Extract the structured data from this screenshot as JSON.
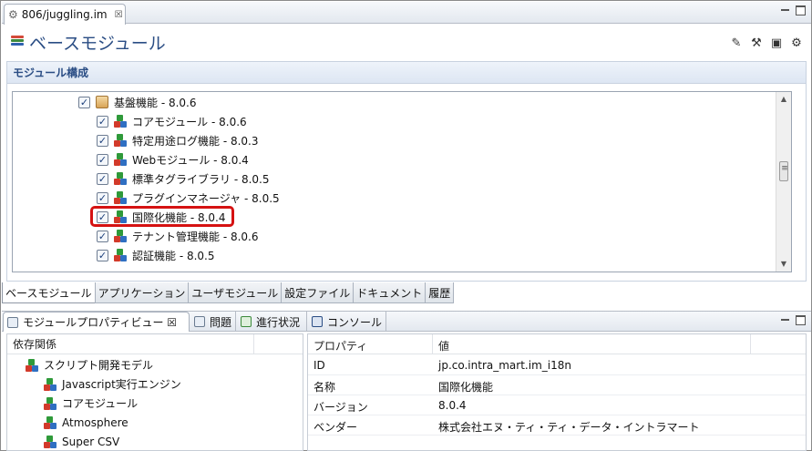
{
  "editor_tab": {
    "label": "806/juggling.im",
    "close": "☒"
  },
  "header": {
    "title": "ベースモジュール"
  },
  "section": {
    "title": "モジュール構成"
  },
  "tree": {
    "parent": {
      "label": "基盤機能 - 8.0.6",
      "checked": true
    },
    "children": [
      {
        "label": "コアモジュール - 8.0.6",
        "checked": true
      },
      {
        "label": "特定用途ログ機能 - 8.0.3",
        "checked": true
      },
      {
        "label": "Webモジュール - 8.0.4",
        "checked": true
      },
      {
        "label": "標準タグライブラリ - 8.0.5",
        "checked": true
      },
      {
        "label": "プラグインマネージャ - 8.0.5",
        "checked": true
      },
      {
        "label": "国際化機能 - 8.0.4",
        "checked": true,
        "highlighted": true
      },
      {
        "label": "テナント管理機能 - 8.0.6",
        "checked": true
      },
      {
        "label": "認証機能 - 8.0.5",
        "checked": true
      }
    ]
  },
  "page_tabs": [
    "ベースモジュール",
    "アプリケーション",
    "ユーザモジュール",
    "設定ファイル",
    "ドキュメント",
    "履歴"
  ],
  "view_tabs": [
    "モジュールプロパティビュー ☒",
    "問題",
    "進行状況",
    "コンソール"
  ],
  "dependencies": {
    "header": "依存関係",
    "rows": [
      {
        "label": "スクリプト開発モデル",
        "level": 0
      },
      {
        "label": "Javascript実行エンジン",
        "level": 1
      },
      {
        "label": "コアモジュール",
        "level": 1
      },
      {
        "label": "Atmosphere",
        "level": 1
      },
      {
        "label": "Super CSV",
        "level": 1
      }
    ]
  },
  "properties": {
    "headers": [
      "プロパティ",
      "値"
    ],
    "rows": [
      {
        "name": "ID",
        "value": "jp.co.intra_mart.im_i18n"
      },
      {
        "name": "名称",
        "value": "国際化機能"
      },
      {
        "name": "バージョン",
        "value": "8.0.4"
      },
      {
        "name": "ベンダー",
        "value": "株式会社エヌ・ティ・ティ・データ・イントラマート"
      }
    ]
  },
  "colors": {
    "accent": "#2a4d84",
    "highlight": "#d51212"
  }
}
